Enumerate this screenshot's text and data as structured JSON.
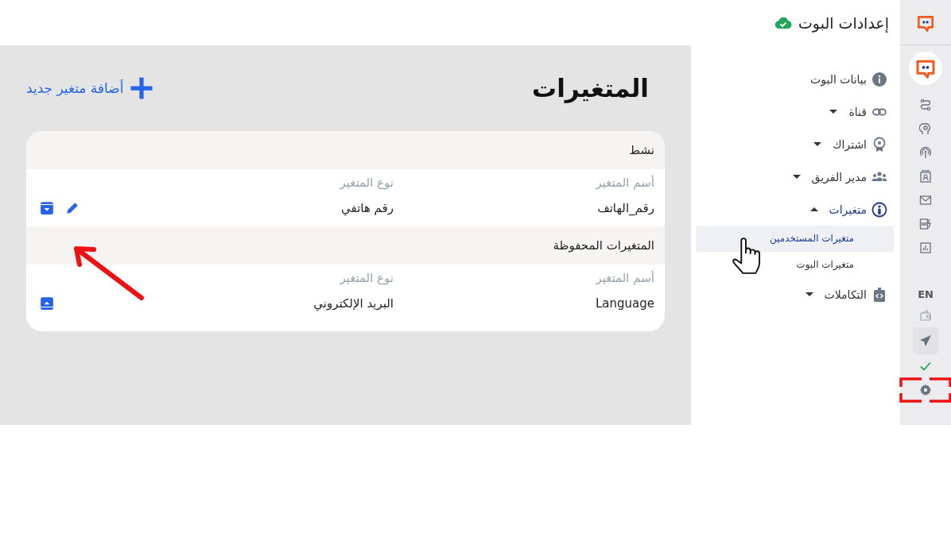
{
  "header": {
    "title": "إعدادات البوت",
    "synced": true
  },
  "rail": {
    "language": "EN"
  },
  "nav": [
    {
      "label": "بيانات البوت",
      "kind": "item",
      "expanded": false
    },
    {
      "label": "قناة",
      "kind": "group",
      "expanded": false
    },
    {
      "label": "اشتراك",
      "kind": "group",
      "expanded": false
    },
    {
      "label": "مدير الفريق",
      "kind": "group",
      "expanded": false
    },
    {
      "label": "متغيرات",
      "kind": "group",
      "expanded": true,
      "children": [
        {
          "label": "متغيرات المستخدمين",
          "selected": true
        },
        {
          "label": "متغيرات البوت",
          "selected": false
        }
      ]
    },
    {
      "label": "التكاملات",
      "kind": "group",
      "expanded": false
    }
  ],
  "main": {
    "title": "المتغيرات",
    "add_button": "أضافة متغير جديد",
    "sections": [
      {
        "title": "نشط",
        "kind": "active",
        "columns": [
          "أسم المتغير",
          "نوع المتغير"
        ],
        "rows": [
          {
            "name": "رقم_الهاتف",
            "type": "رقم هاتفي"
          }
        ]
      },
      {
        "title": "المتغيرات المحفوظة",
        "kind": "archived",
        "columns": [
          "أسم المتغير",
          "نوع المتغير"
        ],
        "rows": [
          {
            "name": "Language",
            "type": "البريد الإلكتروني"
          }
        ]
      }
    ]
  }
}
